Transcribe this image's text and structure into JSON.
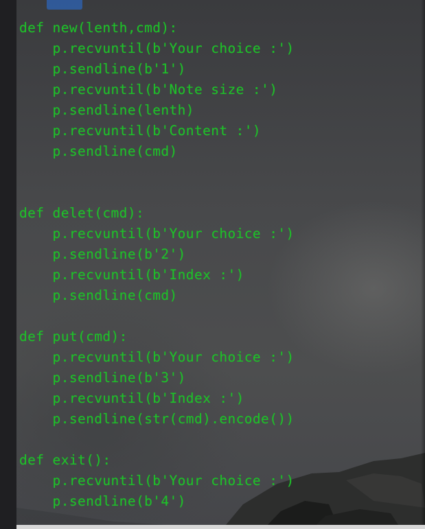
{
  "code_lines": [
    "def new(lenth,cmd):",
    "    p.recvuntil(b'Your choice :')",
    "    p.sendline(b'1')",
    "    p.recvuntil(b'Note size :')",
    "    p.sendline(lenth)",
    "    p.recvuntil(b'Content :')",
    "    p.sendline(cmd)",
    "",
    "",
    "def delet(cmd):",
    "    p.recvuntil(b'Your choice :')",
    "    p.sendline(b'2')",
    "    p.recvuntil(b'Index :')",
    "    p.sendline(cmd)",
    "",
    "def put(cmd):",
    "    p.recvuntil(b'Your choice :')",
    "    p.sendline(b'3')",
    "    p.recvuntil(b'Index :')",
    "    p.sendline(str(cmd).encode())",
    "",
    "def exit():",
    "    p.recvuntil(b'Your choice :')",
    "    p.sendline(b'4')"
  ],
  "colors": {
    "code_text": "#1fbf2a",
    "background": "#48494b",
    "sidebar": "#1f1f22",
    "top_tab": "#2f5fa8"
  }
}
